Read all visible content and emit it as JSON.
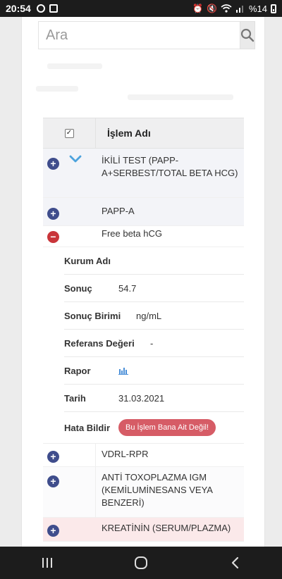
{
  "status_bar": {
    "time": "20:54",
    "battery": "%14"
  },
  "search": {
    "placeholder": "Ara"
  },
  "table": {
    "header": {
      "name_col": "İşlem Adı"
    },
    "rows_top": [
      {
        "label": "İKİLİ TEST (PAPP-A+SERBEST/TOTAL BETA HCG)",
        "expander": "plus",
        "has_chevron": true
      },
      {
        "label": "PAPP-A",
        "expander": "plus"
      },
      {
        "label": "Free beta hCG",
        "expander": "minus"
      }
    ],
    "details": {
      "kurum_label": "Kurum Adı",
      "sonuc_label": "Sonuç",
      "sonuc_value": "54.7",
      "birim_label": "Sonuç Birimi",
      "birim_value": "ng/mL",
      "referans_label": "Referans Değeri",
      "referans_value": "-",
      "rapor_label": "Rapor",
      "rapor_icon": "bar-chart-icon",
      "tarih_label": "Tarih",
      "tarih_value": "31.03.2021",
      "hata_label": "Hata Bildir",
      "hata_button": "Bu İşlem Bana Ait Değil!"
    },
    "rows_bottom": [
      {
        "label": "VDRL-RPR",
        "expander": "plus"
      },
      {
        "label": "ANTİ TOXOPLAZMA IGM (KEMİLUMİNESANS VEYA BENZERİ)",
        "expander": "plus"
      },
      {
        "label": "KREATİNİN (SERUM/PLAZMA)",
        "expander": "plus"
      }
    ]
  },
  "colors": {
    "expand": "#3f4d8c",
    "collapse": "#c9353a",
    "alert_button": "#d65c66",
    "chart_icon": "#4a8fd8"
  }
}
